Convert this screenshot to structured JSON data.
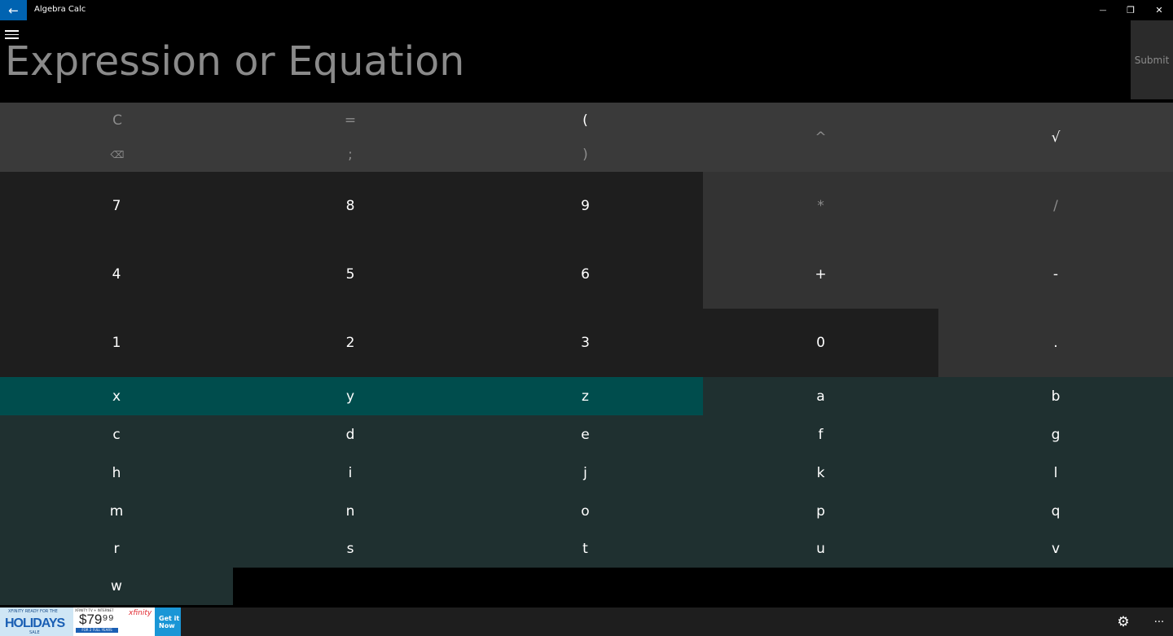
{
  "window": {
    "title": "Algebra Calc",
    "back_icon": "←",
    "minimize_icon": "—",
    "restore_icon": "❐",
    "close_icon": "✕"
  },
  "input": {
    "placeholder": "Expression or Equation",
    "value": ""
  },
  "submit_label": "Submit",
  "keys_top": {
    "clear": "C",
    "backspace": "⌫",
    "equals": "=",
    "semicolon": ";",
    "open_paren": "(",
    "close_paren": ")",
    "caret": "^",
    "sqrt": "√"
  },
  "keys_numbers": [
    "7",
    "8",
    "9",
    "4",
    "5",
    "6",
    "1",
    "2",
    "3",
    "0",
    "."
  ],
  "keys_ops": {
    "multiply": "*",
    "divide": "/",
    "plus": "+",
    "minus": "-"
  },
  "keys_vars": [
    "x",
    "y",
    "z"
  ],
  "keys_letters": [
    "a",
    "b",
    "c",
    "d",
    "e",
    "f",
    "g",
    "h",
    "i",
    "j",
    "k",
    "l",
    "m",
    "n",
    "o",
    "p",
    "q",
    "r",
    "s",
    "t",
    "u",
    "v",
    "w"
  ],
  "ad": {
    "small_text": "XFINITY READY FOR THE",
    "headline": "HOLIDAYS",
    "sale": "SALE",
    "offer_header": "XFINITY TV + INTERNET",
    "price": "$79⁹⁹",
    "offer_band": "FOR 2 FULL YEARS",
    "brand": "xfinity",
    "cta": "Get it Now"
  },
  "bottom": {
    "settings_icon": "⚙",
    "more_icon": "···"
  },
  "colors": {
    "accent": "#0063b1",
    "var_keys": "#004d4d",
    "letter_keys": "#1f3030",
    "number_keys": "#1e1e1e",
    "top_keys": "#3a3a3a"
  }
}
